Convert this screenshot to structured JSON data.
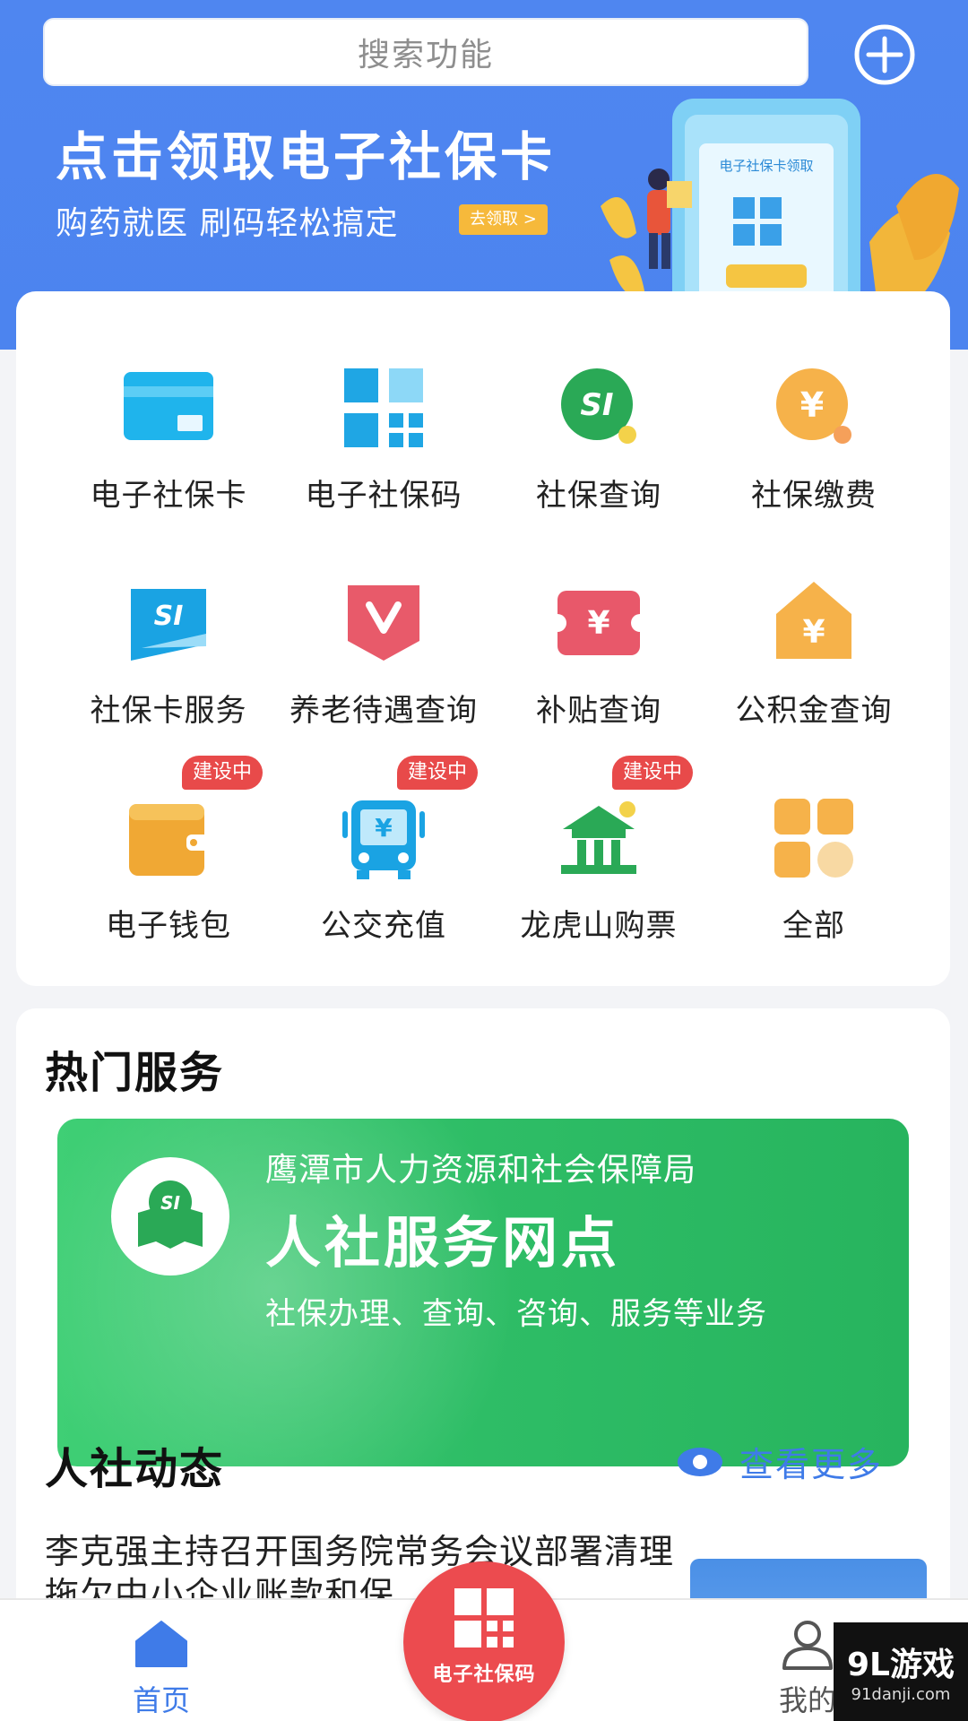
{
  "search": {
    "placeholder": "搜索功能"
  },
  "banner": {
    "title": "点击领取电子社保卡",
    "subtitle": "购药就医  刷码轻松搞定",
    "button": "去领取 >",
    "card_text": "电子社保卡领取"
  },
  "grid": {
    "items": [
      {
        "label": "电子社保卡",
        "icon": "card-icon"
      },
      {
        "label": "电子社保码",
        "icon": "qr-code-icon"
      },
      {
        "label": "社保查询",
        "icon": "si-search-icon"
      },
      {
        "label": "社保缴费",
        "icon": "yuan-payment-icon"
      },
      {
        "label": "社保卡服务",
        "icon": "si-card-service-icon"
      },
      {
        "label": "养老待遇查询",
        "icon": "pension-icon"
      },
      {
        "label": "补贴查询",
        "icon": "subsidy-icon"
      },
      {
        "label": "公积金查询",
        "icon": "housing-fund-icon"
      },
      {
        "label": "电子钱包",
        "icon": "wallet-icon",
        "badge": "建设中"
      },
      {
        "label": "公交充值",
        "icon": "bus-icon",
        "badge": "建设中"
      },
      {
        "label": "龙虎山购票",
        "icon": "temple-ticket-icon",
        "badge": "建设中"
      },
      {
        "label": "全部",
        "icon": "all-apps-icon"
      }
    ]
  },
  "hot": {
    "title": "热门服务",
    "promo": {
      "org": "鹰潭市人力资源和社会保障局",
      "title": "人社服务网点",
      "desc": "社保办理、查询、咨询、服务等业务"
    }
  },
  "news": {
    "title": "人社动态",
    "more": "查看更多",
    "item_title": "李克强主持召开国务院常务会议部署清理拖欠中小企业账款和保"
  },
  "nav": {
    "home": "首页",
    "center": "电子社保码",
    "me": "我的"
  },
  "watermark": {
    "main": "9L游戏",
    "sub": "91danji.com"
  },
  "colors": {
    "header_blue": "#4f86f0",
    "accent_blue": "#3f7be8",
    "green": "#2ebd66",
    "red": "#ec4b4f",
    "orange": "#f6b93b"
  }
}
